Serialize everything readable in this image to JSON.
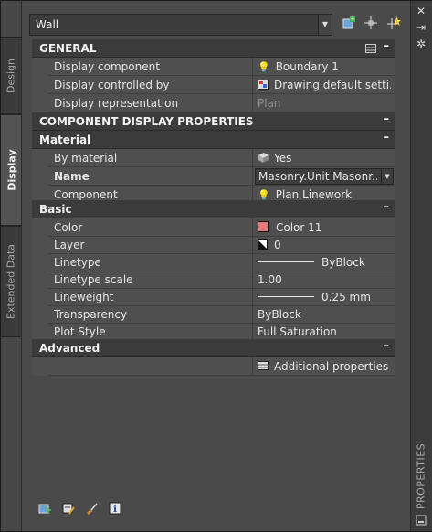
{
  "object_selector": {
    "value": "Wall"
  },
  "tabs": [
    "Design",
    "Display",
    "Extended Data"
  ],
  "sections": {
    "general": "GENERAL",
    "component_display": "COMPONENT DISPLAY PROPERTIES",
    "material": "Material",
    "basic": "Basic",
    "advanced": "Advanced"
  },
  "general": {
    "display_component": {
      "label": "Display component",
      "value": "Boundary 1"
    },
    "display_controlled_by": {
      "label": "Display controlled by",
      "value": "Drawing default setti..."
    },
    "display_representation": {
      "label": "Display representation",
      "value": "Plan"
    }
  },
  "material": {
    "by_material": {
      "label": "By material",
      "value": "Yes"
    },
    "name": {
      "label": "Name",
      "value": "Masonry.Unit Masonr..."
    },
    "component": {
      "label": "Component",
      "value": "Plan Linework"
    }
  },
  "basic": {
    "color": {
      "label": "Color",
      "value": "Color 11",
      "swatch": "#e87878"
    },
    "layer": {
      "label": "Layer",
      "value": "0"
    },
    "linetype": {
      "label": "Linetype",
      "value": "ByBlock"
    },
    "linetype_scale": {
      "label": "Linetype scale",
      "value": "1.00"
    },
    "lineweight": {
      "label": "Lineweight",
      "value": "0.25 mm"
    },
    "transparency": {
      "label": "Transparency",
      "value": "ByBlock"
    },
    "plot_style": {
      "label": "Plot Style",
      "value": "Full Saturation"
    }
  },
  "advanced": {
    "additional": "Additional properties"
  },
  "palette_title": "PROPERTIES",
  "icons": [
    "add-selected-icon",
    "select-objects-icon",
    "quick-select-icon",
    "table-icon",
    "close-icon",
    "auto-hide-icon",
    "settings-icon",
    "bulb-icon",
    "info-icon"
  ]
}
